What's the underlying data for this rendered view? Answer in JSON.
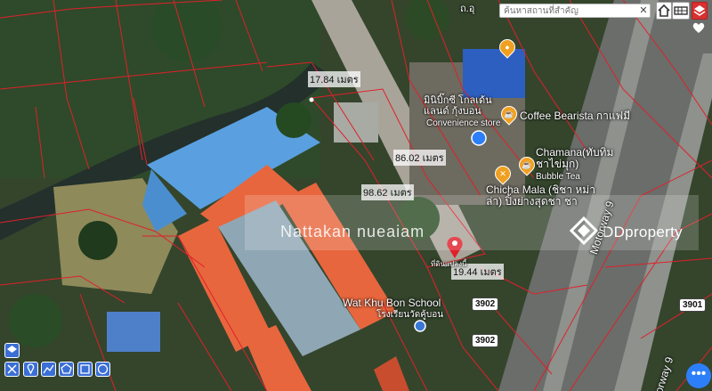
{
  "search": {
    "placeholder": "ค้นหาสถานที่สำคัญ",
    "clear_icon": "close-icon"
  },
  "top_buttons": [
    "home-icon",
    "grid-icon",
    "layers-icon",
    "heart-icon"
  ],
  "measurements": [
    "17.84 เมตร",
    "86.02 เมตร",
    "98.62 เมตร",
    "19.44 เมตร"
  ],
  "pois": [
    {
      "name": "มินิบิ๊กซี โกลเด้น\nแลนด์ กุ้งบอน",
      "sub": "Convenience store"
    },
    {
      "name": "Coffee Bearista กาแฟมี"
    },
    {
      "name": "Chamana(ทับทิม\nชาไข่มุก)",
      "sub": "Bubble Tea"
    },
    {
      "name": "Chicha Mala (ชิชา หม่า\nล่า) ปิ้งย่างสุดชา ชา"
    },
    {
      "name": "Wat Khu Bon School",
      "sub": "โรงเรียนวัดคู้บอน"
    }
  ],
  "road_labels": {
    "motorway_upper": "Motorway 9",
    "motorway_lower": "orway 9"
  },
  "route_shields": [
    "3902",
    "3902",
    "3901"
  ],
  "pin_caption": "ที่ดินแปลงนี้",
  "watermark": {
    "owner": "Nattakan nueaiam",
    "brand": "DDproperty"
  },
  "top_road_fragment": "ถ.อุ",
  "colors": {
    "parcel_lines": "#e0202a",
    "pin": "#e0202a",
    "roof_orange": "#e8663d",
    "roof_blue": "#5aa0e0",
    "tool_blue": "#3b6fd6",
    "fab_blue": "#2d7ff9"
  },
  "draw_tools": [
    "layers-icon",
    "cut-icon",
    "pin-icon",
    "line-icon",
    "polygon-icon",
    "rectangle-icon",
    "circle-icon"
  ]
}
